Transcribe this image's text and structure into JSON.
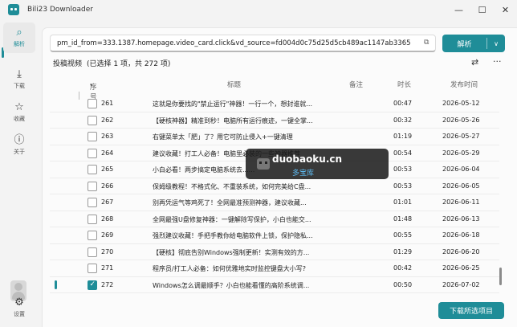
{
  "window": {
    "title": "Bili23 Downloader",
    "controls": [
      "—",
      "☐",
      "✕"
    ]
  },
  "sidebar": {
    "items": [
      {
        "label": "解析",
        "icon": "search-icon",
        "glyph": "⌕"
      },
      {
        "label": "下载",
        "icon": "download-icon",
        "glyph": "⤓"
      },
      {
        "label": "收藏",
        "icon": "star-icon",
        "glyph": "☆"
      },
      {
        "label": "关于",
        "icon": "info-icon",
        "glyph": "ⓘ"
      },
      {
        "label": "设置",
        "icon": "gear-icon",
        "glyph": "⚙"
      }
    ]
  },
  "search": {
    "value": "pm_id_from=333.1387.homepage.video_card.click&vd_source=fd004d0c75d25d5cb489ac1147ab3365",
    "paste_icon": "clipboard-icon",
    "parse_label": "解析",
    "dropdown_glyph": "∨"
  },
  "list": {
    "title": "投稿视频",
    "status": "(已选择 1 项，共 272 项)",
    "filter_icon_glyph": "⇄",
    "more_icon_glyph": "···",
    "columns": {
      "number": "序号",
      "title": "标题",
      "note": "备注",
      "duration": "时长",
      "date": "发布时间"
    },
    "sort_glyph": "▾",
    "rows": [
      {
        "no": "261",
        "title": "这就是你要找的\"禁止运行\"神器！一行一个，想封谁就...",
        "duration": "00:47",
        "date": "2026-05-12",
        "checked": false
      },
      {
        "no": "262",
        "title": "【硬核神器】精准到秒！电脑所有运行痕迹，一键全掌...",
        "duration": "00:32",
        "date": "2026-05-26",
        "checked": false
      },
      {
        "no": "263",
        "title": "右键菜单太「肥」了？用它可防止侵入+一键清理",
        "duration": "01:19",
        "date": "2026-05-27",
        "checked": false
      },
      {
        "no": "264",
        "title": "建议收藏！打工人必备！电脑里必装的一些神器推荐",
        "duration": "00:54",
        "date": "2026-05-29",
        "checked": false
      },
      {
        "no": "265",
        "title": "小白必看！两步搞定电脑系统去......",
        "duration": "00:53",
        "date": "2026-06-04",
        "checked": false
      },
      {
        "no": "266",
        "title": "保姆级教程！不格式化、不重装系统，如何完美给C盘...",
        "duration": "00:53",
        "date": "2026-06-05",
        "checked": false
      },
      {
        "no": "267",
        "title": "别再凭运气等鸡死了！全网最准预测神器，建议收藏...",
        "duration": "01:01",
        "date": "2026-06-11",
        "checked": false
      },
      {
        "no": "268",
        "title": "全网最强U盘修复神器：一键解除写保护，小白也能交...",
        "duration": "01:48",
        "date": "2026-06-13",
        "checked": false
      },
      {
        "no": "269",
        "title": "强烈建议收藏！手把手教你给电脑软件上锁，保护隐私...",
        "duration": "00:55",
        "date": "2026-06-18",
        "checked": false
      },
      {
        "no": "270",
        "title": "【硬核】彻底告别Windows强制更新！实测有效的方...",
        "duration": "01:29",
        "date": "2026-06-20",
        "checked": false
      },
      {
        "no": "271",
        "title": "程序员/打工人必备：如何优雅地实时监控键盘大小写?",
        "duration": "00:42",
        "date": "2026-06-25",
        "checked": false
      },
      {
        "no": "272",
        "title": "Windows怎么调最顺手？小白也能看懂的高阶系统调...",
        "duration": "00:50",
        "date": "2026-07-02",
        "checked": true
      }
    ]
  },
  "watermark": {
    "site": "duobaoku.cn",
    "sub": "多宝库"
  },
  "download_button": "下载所选项目",
  "colors": {
    "accent": "#1f8d98"
  }
}
